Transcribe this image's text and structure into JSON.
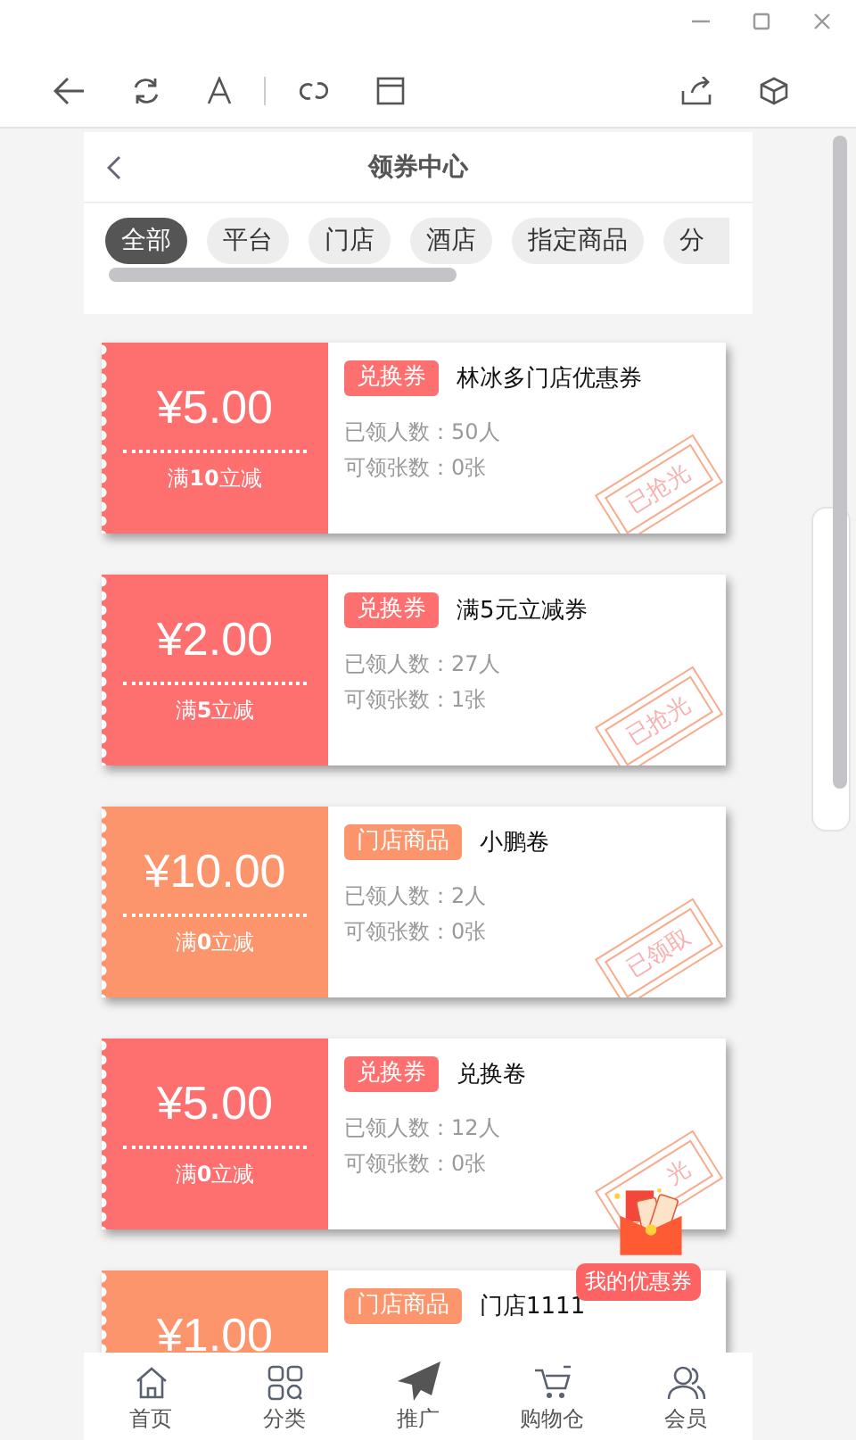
{
  "header": {
    "title": "领券中心"
  },
  "tabs": [
    {
      "label": "全部",
      "selected": true
    },
    {
      "label": "平台",
      "selected": false
    },
    {
      "label": "门店",
      "selected": false
    },
    {
      "label": "酒店",
      "selected": false
    },
    {
      "label": "指定商品",
      "selected": false
    },
    {
      "label": "分",
      "selected": false
    }
  ],
  "coupons": [
    {
      "kind": "exchange",
      "price": "¥5.00",
      "condition": "满**10**立减",
      "tag": "兑换券",
      "title": "林冰多门店优惠券",
      "claimed": "已领人数：50人",
      "remaining": "可领张数：0张",
      "stamp": "已抢光"
    },
    {
      "kind": "exchange",
      "price": "¥2.00",
      "condition": "满**5**立减",
      "tag": "兑换券",
      "title": "满5元立减券",
      "claimed": "已领人数：27人",
      "remaining": "可领张数：1张",
      "stamp": "已抢光"
    },
    {
      "kind": "store",
      "price": "¥10.00",
      "condition": "满**0**立减",
      "tag": "门店商品",
      "title": "小鹏卷",
      "claimed": "已领人数：2人",
      "remaining": "可领张数：0张",
      "stamp": "已领取"
    },
    {
      "kind": "exchange",
      "price": "¥5.00",
      "condition": "满**0**立减",
      "tag": "兑换券",
      "title": "兑换卷",
      "claimed": "已领人数：12人",
      "remaining": "可领张数：0张",
      "stamp": "光"
    },
    {
      "kind": "store",
      "price": "¥1.00",
      "tag": "门店商品",
      "title": "门店1111"
    }
  ],
  "floating_button": {
    "label": "我的优惠券"
  },
  "bottom_nav": [
    {
      "label": "首页",
      "kind": "home"
    },
    {
      "label": "分类",
      "kind": "grid"
    },
    {
      "label": "推广",
      "kind": "plane"
    },
    {
      "label": "购物仓",
      "kind": "cart"
    },
    {
      "label": "会员",
      "kind": "user"
    }
  ]
}
